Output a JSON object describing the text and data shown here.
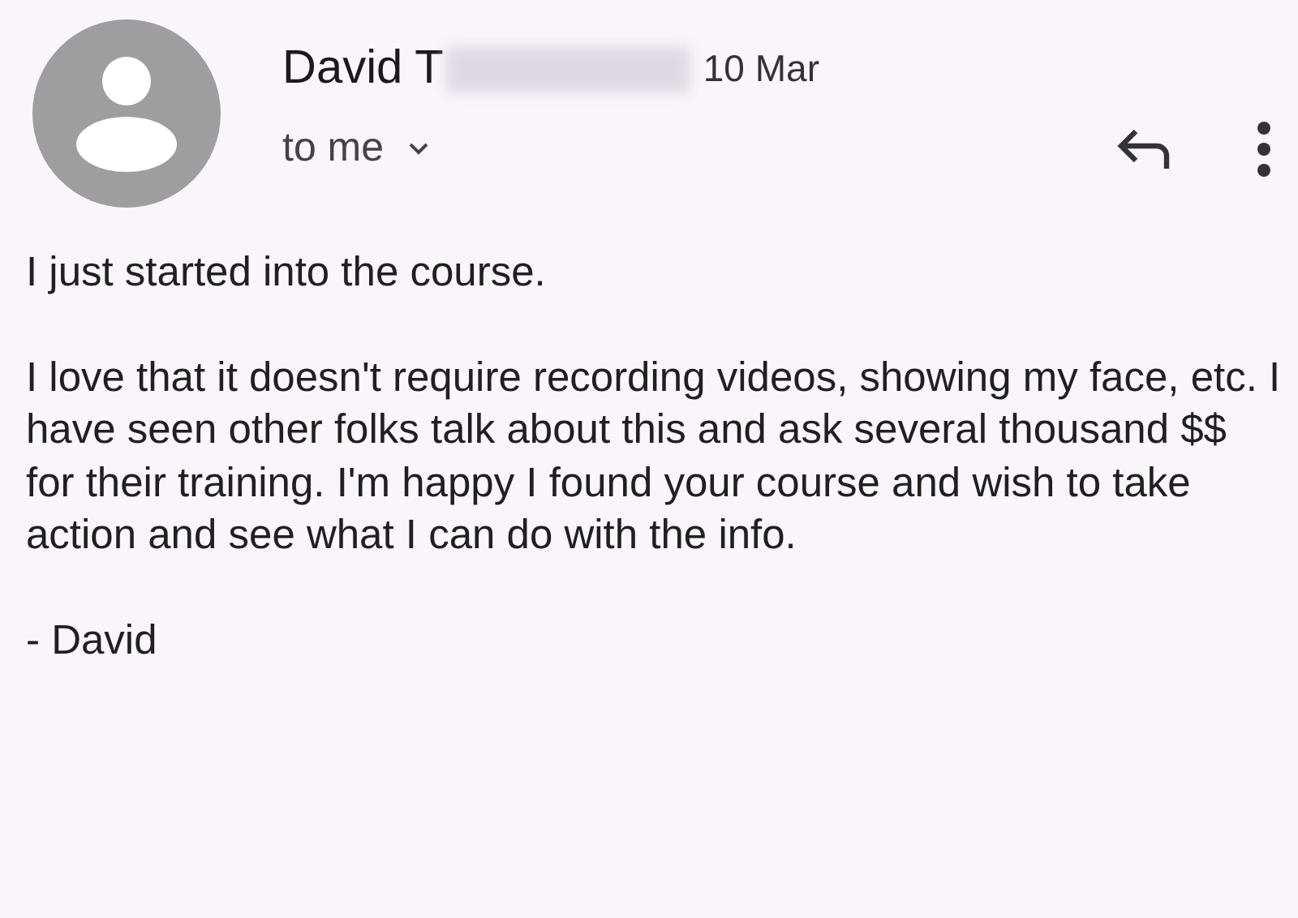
{
  "message": {
    "sender": "David T",
    "date": "10 Mar",
    "recipient": "to me"
  },
  "body": [
    "I just started into the course.",
    "I love that it doesn't require recording videos, showing my face, etc. I have seen other folks talk about this and ask several thousand $$ for their training. I'm happy I found your course and wish to take action and see what I can do with the info.",
    "- David"
  ]
}
